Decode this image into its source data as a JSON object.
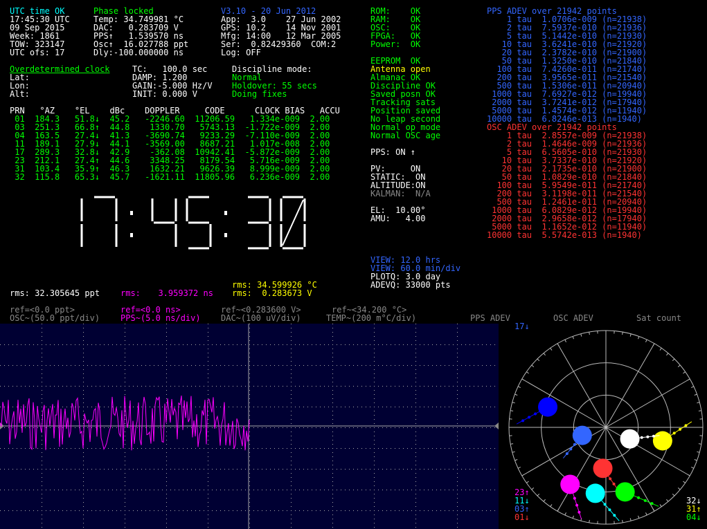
{
  "colors": {
    "white": "#ffffff",
    "cyan": "#00ffff",
    "green": "#00ff00",
    "blue": "#3366ff",
    "red": "#ff3333",
    "yellow": "#ffff00",
    "magenta": "#ff00ff",
    "gray": "#888888"
  },
  "status": {
    "left": [
      [
        "UTC time OK",
        "#00ffff"
      ],
      [
        "17:45:30 UTC",
        "#ffffff"
      ],
      [
        "09 Sep 2015",
        "#ffffff"
      ],
      [
        "Week: 1861",
        "#ffffff"
      ],
      [
        "TOW: 323147",
        "#ffffff"
      ],
      [
        "UTC ofs: 17",
        "#ffffff"
      ]
    ],
    "mid": [
      [
        "Phase locked",
        "#00ff00"
      ],
      [
        "Temp: 34.749981 °C",
        "#ffffff"
      ],
      [
        "DAC:   0.283709 V",
        "#ffffff"
      ],
      [
        "PPS↑   1.539570 ns",
        "#ffffff"
      ],
      [
        "Osc↑  16.027788 ppt",
        "#ffffff"
      ],
      [
        "Dly:-100.000000 ns",
        "#ffffff"
      ]
    ],
    "ver": [
      [
        "V3.10 - 20 Jun 2012",
        "#3366ff"
      ],
      [
        "App:  3.0    27 Jun 2002",
        "#ffffff"
      ],
      [
        "GPS: 10.2    14 Nov 2001",
        "#ffffff"
      ],
      [
        "Mfg: 14:00   12 Mar 2005",
        "#ffffff"
      ],
      [
        "Ser:  0.82429360  COM:2",
        "#ffffff"
      ],
      [
        "Log: OFF",
        "#ffffff"
      ]
    ]
  },
  "health": [
    [
      "ROM:    OK",
      "#00ff00"
    ],
    [
      "RAM:    OK",
      "#00ff00"
    ],
    [
      "OSC:    OK",
      "#00ff00"
    ],
    [
      "FPGA:   OK",
      "#00ff00"
    ],
    [
      "Power:  OK",
      "#00ff00"
    ],
    [
      "",
      ""
    ],
    [
      "EEPROM  OK",
      "#00ff00"
    ],
    [
      "Antenna open",
      "#ffff00"
    ],
    [
      "Almanac OK",
      "#00ff00"
    ],
    [
      "Discipline OK",
      "#00ff00"
    ],
    [
      "Saved posn OK",
      "#00ff00"
    ],
    [
      "Tracking sats",
      "#00ff00"
    ],
    [
      "Position saved",
      "#00ff00"
    ],
    [
      "No leap second",
      "#00ff00"
    ],
    [
      "Normal op mode",
      "#00ff00"
    ],
    [
      "Normal OSC age",
      "#00ff00"
    ]
  ],
  "position": {
    "mode_title": "Overdetermined clock",
    "lat": "Lat:",
    "lon": "Lon:",
    "alt": "Alt:",
    "tc": "TC:   100.0 sec",
    "damp": "DAMP: 1.200",
    "gain": "GAIN:-5.000 Hz/V",
    "init": "INIT: 0.000 V",
    "disc_title": "Discipline mode:",
    "disc": [
      "Normal",
      "Holdover: 55 secs",
      "Doing fixes"
    ]
  },
  "sat_table": {
    "header": "PRN   °AZ    °EL    dBc    DOPPLER     CODE      CLOCK BIAS   ACCU",
    "rows": [
      [
        " 01",
        "184.3",
        " 51.8↓",
        "45.2",
        " -2246.60",
        "11206.59",
        " 1.334e-009",
        "2.00"
      ],
      [
        " 03",
        "251.3",
        " 66.8↑",
        "44.8",
        "  1330.70",
        " 5743.13",
        "-1.722e-009",
        "2.00"
      ],
      [
        " 04",
        "163.5",
        " 27.4↓",
        "41.3",
        " -3690.74",
        " 9233.29",
        "-7.110e-009",
        "2.00"
      ],
      [
        " 11",
        "189.1",
        " 27.9↓",
        "44.1",
        " -3569.00",
        " 8687.21",
        " 1.017e-008",
        "2.00"
      ],
      [
        " 17",
        "289.3",
        " 32.8↓",
        "42.9",
        "  -362.08",
        "10942.41",
        "-5.872e-009",
        "2.00"
      ],
      [
        " 23",
        "212.1",
        " 27.4↑",
        "44.6",
        "  3348.25",
        " 8179.54",
        " 5.716e-009",
        "2.00"
      ],
      [
        " 31",
        "103.4",
        " 35.9↑",
        "46.3",
        "  1632.21",
        " 9626.39",
        " 8.999e-009",
        "2.00"
      ],
      [
        " 32",
        "115.8",
        " 65.3↓",
        "45.7",
        " -1621.11",
        "11805.96",
        " 6.236e-009",
        "2.00"
      ]
    ]
  },
  "pps": {
    "pps_label": "PPS: ON ↑",
    "lines": [
      "PV:     ON",
      "STATIC:  ON",
      "ALTITUDE:ON"
    ],
    "kalman": "KALMAN:  N/A",
    "el": "EL:  10.00°",
    "amu": "AMU:   4.00"
  },
  "view": {
    "view1": "VIEW: 12.0 hrs",
    "view2": "VIEW: 60.0 min/div",
    "plotq": "PLOTQ: 3.0 day",
    "adevq": "ADEVQ: 33000 pts"
  },
  "clock": {
    "time": "17:45:30"
  },
  "pps_adev": {
    "title": "PPS ADEV over 21942 points",
    "rows": [
      "    1 tau  1.0706e-009 (n=21938)",
      "    2 tau  7.5937e-010 (n=21936)",
      "    5 tau  5.1442e-010 (n=21930)",
      "   10 tau  3.6241e-010 (n=21920)",
      "   20 tau  2.3782e-010 (n=21900)",
      "   50 tau  1.3250e-010 (n=21840)",
      "  100 tau  7.4260e-011 (n=21740)",
      "  200 tau  3.9565e-011 (n=21540)",
      "  500 tau  1.5306e-011 (n=20940)",
      " 1000 tau  7.6927e-012 (n=19940)",
      " 2000 tau  3.7241e-012 (n=17940)",
      " 5000 tau  1.4574e-012 (n=11940)",
      "10000 tau  6.8246e-013 (n=1940)"
    ]
  },
  "osc_adev": {
    "title": "OSC ADEV over 21942 points",
    "rows": [
      "    1 tau  2.8557e-009 (n=21938)",
      "    2 tau  1.4646e-009 (n=21936)",
      "    5 tau  6.5605e-010 (n=21930)",
      "   10 tau  3.7337e-010 (n=21920)",
      "   20 tau  2.1735e-010 (n=21900)",
      "   50 tau  1.0829e-010 (n=21840)",
      "  100 tau  5.9549e-011 (n=21740)",
      "  200 tau  3.1198e-011 (n=21540)",
      "  500 tau  1.2461e-011 (n=20940)",
      " 1000 tau  6.0829e-012 (n=19940)",
      " 2000 tau  2.9658e-012 (n=17940)",
      " 5000 tau  1.1652e-012 (n=11940)",
      "10000 tau  5.5742e-013 (n=1940)"
    ]
  },
  "rms": {
    "osc": "rms: 32.305645 ppt",
    "pps_label": "rms:",
    "pps_value": "  3.959372 ns",
    "temp": "rms: 34.599926 °C",
    "dac": "rms:  0.283673 V"
  },
  "legend": {
    "ref_osc": "ref=<0.0 ppt>",
    "osc_scale": "OSC~(50.0 ppt/div)",
    "ref_pps": "ref=<0.0 ns>",
    "pps_scale": "PPS~(5.0 ns/div)",
    "ref_dac": "ref~<0.283600 V>",
    "dac_scale": "DAC~(100 uV/div)",
    "ref_temp": "ref~<34.200 °C>",
    "temp_scale": "TEMP~(200 m°C/div)",
    "pps_adev": "PPS ADEV",
    "osc_adev": "OSC ADEV",
    "sat_count": "Sat count"
  },
  "sat_map": {
    "top_label": "17↓",
    "left_labels": [
      [
        "23↑",
        "#ff00ff"
      ],
      [
        "11↓",
        "#00ffff"
      ],
      [
        "03↑",
        "#3366ff"
      ],
      [
        "01↓",
        "#ff3333"
      ]
    ],
    "right_labels": [
      [
        "32↓",
        "#ffffff"
      ],
      [
        "31↑",
        "#ffff00"
      ],
      [
        "04↓",
        "#00ff00"
      ]
    ],
    "sats": [
      {
        "prn": "01",
        "az": 184.3,
        "el": 51.8,
        "color": "#ff3333"
      },
      {
        "prn": "03",
        "az": 251.3,
        "el": 66.8,
        "color": "#3366ff"
      },
      {
        "prn": "04",
        "az": 163.5,
        "el": 27.4,
        "color": "#00ff00"
      },
      {
        "prn": "11",
        "az": 189.1,
        "el": 27.9,
        "color": "#00ffff"
      },
      {
        "prn": "17",
        "az": 289.3,
        "el": 32.8,
        "color": "#0000ff"
      },
      {
        "prn": "23",
        "az": 212.1,
        "el": 27.4,
        "color": "#ff00ff"
      },
      {
        "prn": "31",
        "az": 103.4,
        "el": 35.9,
        "color": "#ffff00"
      },
      {
        "prn": "32",
        "az": 115.8,
        "el": 65.3,
        "color": "#ffffff"
      }
    ]
  }
}
